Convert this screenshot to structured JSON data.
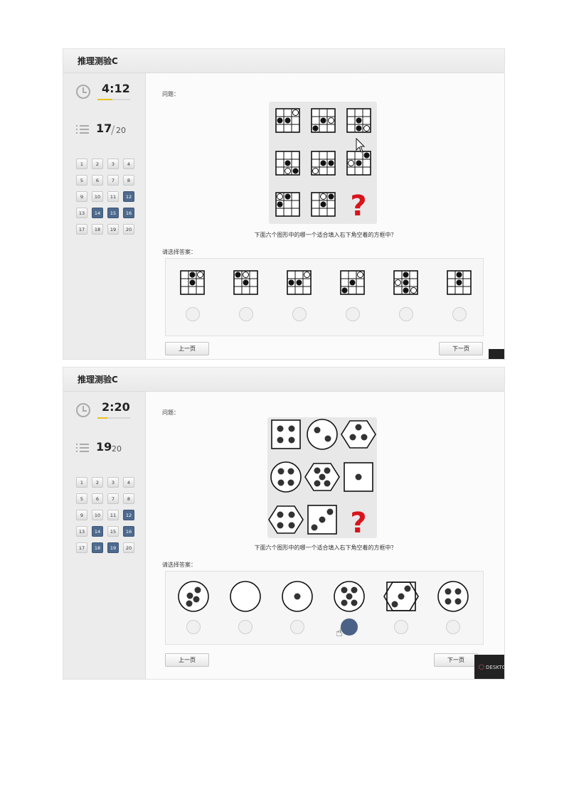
{
  "screens": [
    {
      "title": "推理测验C",
      "timer": "4:12",
      "timer_progress": 0.45,
      "progress": {
        "current": "17",
        "separator": "/",
        "total": "20"
      },
      "questions": [
        {
          "n": "1",
          "done": false
        },
        {
          "n": "2",
          "done": false
        },
        {
          "n": "3",
          "done": false
        },
        {
          "n": "4",
          "done": false
        },
        {
          "n": "5",
          "done": false
        },
        {
          "n": "6",
          "done": false
        },
        {
          "n": "7",
          "done": false
        },
        {
          "n": "8",
          "done": false
        },
        {
          "n": "9",
          "done": false
        },
        {
          "n": "10",
          "done": false
        },
        {
          "n": "11",
          "done": false
        },
        {
          "n": "12",
          "done": true
        },
        {
          "n": "13",
          "done": false
        },
        {
          "n": "14",
          "done": true
        },
        {
          "n": "15",
          "done": true
        },
        {
          "n": "16",
          "done": true
        },
        {
          "n": "17",
          "done": false
        },
        {
          "n": "18",
          "done": false
        },
        {
          "n": "19",
          "done": false
        },
        {
          "n": "20",
          "done": false
        }
      ],
      "question_label": "问题：",
      "question_text": "下面六个图形中的哪一个适合填入右下角空着的方框中？",
      "missing_mark": "?",
      "answer_label": "请选择答案：",
      "selected_option": null,
      "prev_label": "上一页",
      "next_label": "下一页"
    },
    {
      "title": "推理测验C",
      "timer": "2:20",
      "timer_progress": 0.3,
      "progress": {
        "current": "19",
        "separator": "",
        "total": "20"
      },
      "questions": [
        {
          "n": "1",
          "done": false
        },
        {
          "n": "2",
          "done": false
        },
        {
          "n": "3",
          "done": false
        },
        {
          "n": "4",
          "done": false
        },
        {
          "n": "5",
          "done": false
        },
        {
          "n": "6",
          "done": false
        },
        {
          "n": "7",
          "done": false
        },
        {
          "n": "8",
          "done": false
        },
        {
          "n": "9",
          "done": false
        },
        {
          "n": "10",
          "done": false
        },
        {
          "n": "11",
          "done": false
        },
        {
          "n": "12",
          "done": true
        },
        {
          "n": "13",
          "done": false
        },
        {
          "n": "14",
          "done": true
        },
        {
          "n": "15",
          "done": false
        },
        {
          "n": "16",
          "done": true
        },
        {
          "n": "17",
          "done": false
        },
        {
          "n": "18",
          "done": true
        },
        {
          "n": "19",
          "done": true
        },
        {
          "n": "20",
          "done": false
        }
      ],
      "question_label": "问题：",
      "question_text": "下面六个图形中的哪一个适合填入右下角空着的方框中？",
      "missing_mark": "?",
      "answer_label": "请选择答案：",
      "selected_option": 4,
      "prev_label": "上一页",
      "next_label": "下一页"
    }
  ],
  "taskbar_text": "DESKTO",
  "colors": {
    "accent": "#4e6a8e",
    "question_mark": "#d8141c",
    "timer_bar": "#e8c21a"
  }
}
